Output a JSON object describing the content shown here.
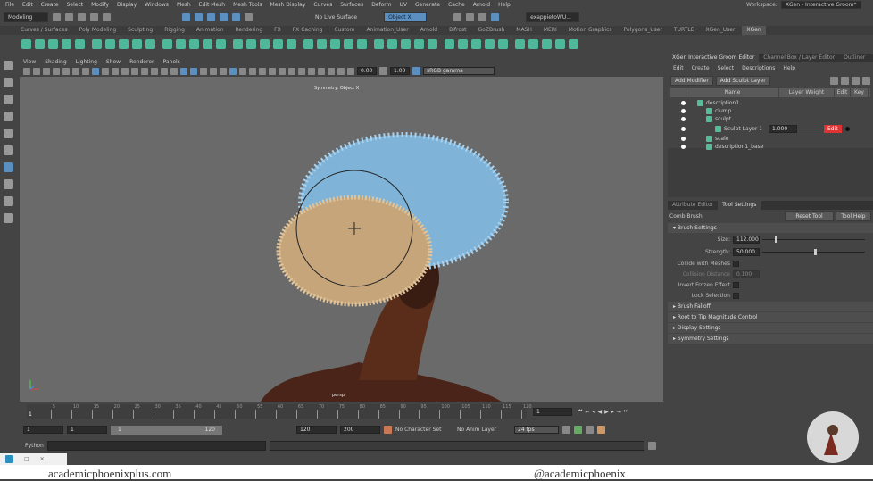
{
  "menubar": [
    "File",
    "Edit",
    "Create",
    "Select",
    "Modify",
    "Display",
    "Windows",
    "Mesh",
    "Edit Mesh",
    "Mesh Tools",
    "Mesh Display",
    "Curves",
    "Surfaces",
    "Deform",
    "UV",
    "Generate",
    "Cache",
    "Arnold",
    "Help"
  ],
  "status": {
    "mode": "Modeling",
    "live_surface": "No Live Surface",
    "symmetry": "Object X",
    "user": "exappietoWU...",
    "workspace_label": "Workspace:",
    "workspace": "XGen - Interactive Groom*"
  },
  "shelf_tabs": [
    "Curves / Surfaces",
    "Poly Modeling",
    "Sculpting",
    "Rigging",
    "Animation",
    "Rendering",
    "FX",
    "FX Caching",
    "Custom",
    "Animation_User",
    "Arnold",
    "Bifrost",
    "GoZBrush",
    "MASH",
    "MERI",
    "Motion Graphics",
    "Polygons_User",
    "TURTLE",
    "XGen_User",
    "XGen"
  ],
  "shelf_active": "XGen",
  "viewport": {
    "menu": [
      "View",
      "Shading",
      "Lighting",
      "Show",
      "Renderer",
      "Panels"
    ],
    "exposure": "0.00",
    "gamma": "1.00",
    "color_space": "sRGB gamma",
    "hud_title": "Symmetry: Object X",
    "camera": "persp"
  },
  "groom_editor": {
    "tabs": [
      "XGen Interactive Groom Editor",
      "Channel Box / Layer Editor",
      "Outliner"
    ],
    "menu": [
      "Edit",
      "Create",
      "Select",
      "Descriptions",
      "Help"
    ],
    "add_modifier": "Add Modifier",
    "add_sculpt_layer": "Add Sculpt Layer",
    "columns": [
      "Name",
      "Layer Weight",
      "Edit",
      "Key"
    ],
    "nodes": [
      {
        "name": "description1",
        "depth": 0
      },
      {
        "name": "clump",
        "depth": 1
      },
      {
        "name": "sculpt",
        "depth": 1
      },
      {
        "name": "Sculpt Layer 1",
        "depth": 2,
        "weight": "1.000",
        "edit": "Edit"
      },
      {
        "name": "scale",
        "depth": 1
      },
      {
        "name": "description1_base",
        "depth": 1
      }
    ]
  },
  "tool_settings": {
    "tabs": [
      "Attribute Editor",
      "Tool Settings"
    ],
    "tool_name": "Comb Brush",
    "reset": "Reset Tool",
    "help": "Tool Help",
    "brush_section": "Brush Settings",
    "size_label": "Size:",
    "size": "112.000",
    "size_fraction": 0.12,
    "strength_label": "Strength:",
    "strength": "50.000",
    "strength_fraction": 0.5,
    "collide_label": "Collide with Meshes",
    "collision_label": "Collision Distance",
    "collision": "0.100",
    "invert_label": "Invert Frozen Effect",
    "lock_label": "Lock Selection",
    "sections": [
      "Brush Falloff",
      "Root to Tip Magnitude Control",
      "Display Settings",
      "Symmetry Settings"
    ]
  },
  "timeline": {
    "ticks": [
      "5",
      "10",
      "15",
      "20",
      "25",
      "30",
      "35",
      "40",
      "45",
      "50",
      "55",
      "60",
      "65",
      "70",
      "75",
      "80",
      "85",
      "90",
      "95",
      "100",
      "105",
      "110",
      "115",
      "120"
    ],
    "current": "1",
    "frame_field": "1"
  },
  "range": {
    "start": "1",
    "playback_start": "1",
    "slider_start": "1",
    "slider_end": "120",
    "playback_end": "120",
    "end": "200",
    "character_set": "No Character Set",
    "anim_layer": "No Anim Layer",
    "fps": "24 fps"
  },
  "python": {
    "label": "Python"
  },
  "footer": {
    "left": "academicphoenixplus.com",
    "right": "@academicphoenix"
  }
}
